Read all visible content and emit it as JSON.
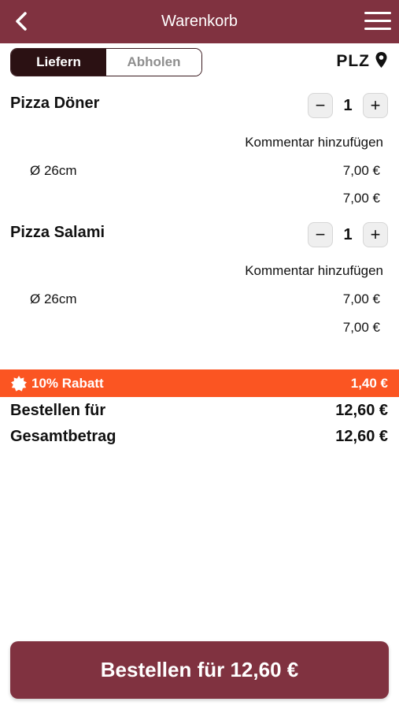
{
  "header": {
    "title": "Warenkorb",
    "back_icon": "back-arrow-icon",
    "menu_icon": "hamburger-menu-icon",
    "color": "#803240"
  },
  "mode": {
    "deliver_label": "Liefern",
    "pickup_label": "Abholen",
    "selected": "Liefern"
  },
  "location": {
    "label": "PLZ",
    "icon": "location-pin-icon"
  },
  "items": [
    {
      "name": "Pizza Döner",
      "quantity": "1",
      "minus": "−",
      "plus": "+",
      "comment_label": "Kommentar hinzufügen",
      "size": "Ø 26cm",
      "size_price": "7,00 €",
      "total": "7,00 €"
    },
    {
      "name": "Pizza Salami",
      "quantity": "1",
      "minus": "−",
      "plus": "+",
      "comment_label": "Kommentar hinzufügen",
      "size": "Ø 26cm",
      "size_price": "7,00 €",
      "total": "7,00 €"
    }
  ],
  "discount": {
    "label": "10% Rabatt",
    "amount": "1,40 €",
    "icon": "discount-badge-icon",
    "color": "#fb5522"
  },
  "summary": {
    "order_for_label": "Bestellen für",
    "order_for_value": "12,60 €",
    "total_label": "Gesamtbetrag",
    "total_value": "12,60 €"
  },
  "order_button": {
    "label": "Bestellen für 12,60 €"
  }
}
